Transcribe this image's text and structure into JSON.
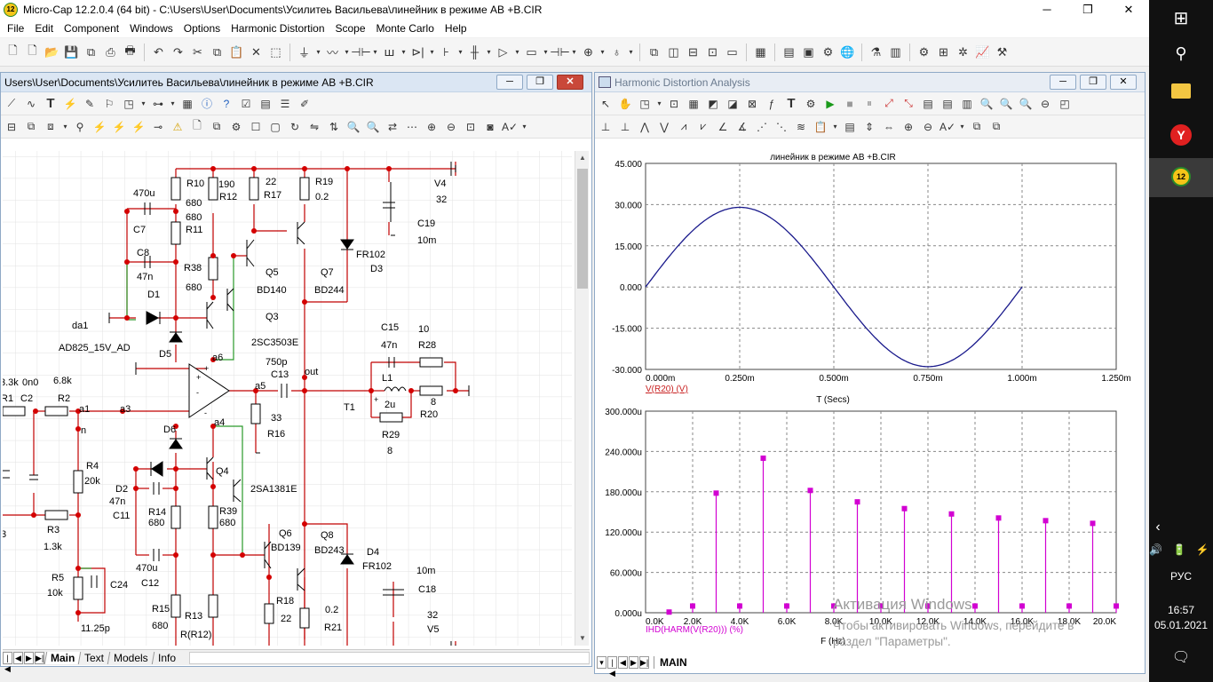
{
  "window": {
    "title": "Micro-Cap 12.2.0.4 (64 bit) - C:\\Users\\User\\Documents\\Усилитеь Васильева\\линейник в режиме АВ +B.CIR",
    "app_icon_text": "12",
    "min": "─",
    "max": "❐",
    "close": "✕"
  },
  "menu": [
    "File",
    "Edit",
    "Component",
    "Windows",
    "Options",
    "Harmonic Distortion",
    "Scope",
    "Monte Carlo",
    "Help"
  ],
  "schematic": {
    "title": "Users\\User\\Documents\\Усилитеь Васильева\\линейник в режиме АВ +B.CIR",
    "tabs": [
      "Main",
      "Text",
      "Models",
      "Info"
    ],
    "active_tab": "Main",
    "labels": {
      "r10": "R10",
      "r10v": "190",
      "r12": "R12",
      "r17v": "22",
      "r17": "R17",
      "r19": "R19",
      "r19v": "0.2",
      "v4": "V4",
      "v4v": "32",
      "c7v": "470u",
      "c7": "C7",
      "r10b": "680",
      "r11v": "680",
      "r11": "R11",
      "c19": "C19",
      "c19v": "10m",
      "c8": "C8",
      "c8v": "47n",
      "r38": "R38",
      "r38v": "680",
      "q5": "Q5",
      "q5t": "BD140",
      "q7": "Q7",
      "q7t": "BD244",
      "fr1": "FR102",
      "d3": "D3",
      "d1": "D1",
      "da1": "da1",
      "ad": "AD825_15V_AD",
      "q3": "Q3",
      "q3t": "2SC3503E",
      "d5": "D5",
      "a6": "a6",
      "c15": "C15",
      "c15v": "47n",
      "r28v": "10",
      "r28": "R28",
      "r750": "750p",
      "c13": "C13",
      "out": "out",
      "l1": "L1",
      "l1v": "2u",
      "r1v": "3.3k",
      "c2v": "0n0",
      "r2v": "6.8k",
      "r1": "R1",
      "c2": "C2",
      "r2": "R2",
      "a1": "a1",
      "a3": "a3",
      "a5": "a5",
      "t1": "T1",
      "r20v": "8",
      "r20": "R20",
      "r16v": "33",
      "r16": "R16",
      "r29": "R29",
      "r29v": "8",
      "n": "n",
      "a4": "a4",
      "d6": "D6",
      "r4": "R4",
      "r4v": "20k",
      "q4": "Q4",
      "q4t": "2SA1381E",
      "d2": "D2",
      "d2v": "47n",
      "c11": "C11",
      "r14": "R14",
      "r14v": "680",
      "r39": "R39",
      "r39v": "680",
      "r3": "R3",
      "r3v": "1.3k",
      "q6": "Q6",
      "q6t": "BD139",
      "q8": "Q8",
      "q8t": "BD243",
      "d4": "D4",
      "fr2": "FR102",
      "c12v": "470u",
      "c12": "C12",
      "c18v": "10m",
      "c18": "C18",
      "r5": "R5",
      "r5v": "10k",
      "c24": "C24",
      "r18": "R18",
      "r18v": "22",
      "r21v": "0.2",
      "r21": "R21",
      "r15": "R15",
      "r15v": "680",
      "r13": "R13",
      "r12b": "R(R12)",
      "c24v": "11.25p",
      "v5v": "32",
      "v5": "V5",
      "v3": "3"
    }
  },
  "hda": {
    "title": "Harmonic Distortion Analysis",
    "tabs": [
      "MAIN"
    ]
  },
  "chart_data": [
    {
      "type": "line",
      "title": "линейник в режиме АВ +B.CIR",
      "xlabel": "T (Secs)",
      "ylabel": "V(R20) (V)",
      "xlim": [
        0,
        0.00125
      ],
      "ylim": [
        -30,
        45
      ],
      "x_ticks": [
        "0.000m",
        "0.250m",
        "0.500m",
        "0.750m",
        "1.000m",
        "1.250m"
      ],
      "y_ticks": [
        "45.000",
        "30.000",
        "15.000",
        "0.000",
        "-15.000",
        "-30.000"
      ],
      "grid": true,
      "series": [
        {
          "name": "V(R20) (V)",
          "color": "#1a1a8c",
          "amplitude": 29,
          "period": 0.001,
          "x_end": 0.001
        }
      ]
    },
    {
      "type": "bar",
      "xlabel": "F (Hz)",
      "ylabel": "IHD(HARM(V(R20))) (%)",
      "xlim": [
        0,
        20000
      ],
      "ylim": [
        0,
        0.0003
      ],
      "x_ticks": [
        "0.0K",
        "2.0K",
        "4.0K",
        "6.0K",
        "8.0K",
        "10.0K",
        "12.0K",
        "14.0K",
        "16.0K",
        "18.0K",
        "20.0K"
      ],
      "y_ticks": [
        "300.000u",
        "240.000u",
        "180.000u",
        "120.000u",
        "60.000u",
        "0.000u"
      ],
      "grid": true,
      "series": [
        {
          "name": "IHD(HARM(V(R20))) (%)",
          "color": "#d200d2",
          "x": [
            1000,
            2000,
            3000,
            4000,
            5000,
            6000,
            7000,
            8000,
            9000,
            10000,
            11000,
            12000,
            13000,
            14000,
            15000,
            16000,
            17000,
            18000,
            19000,
            20000
          ],
          "values": [
            1e-06,
            1e-05,
            0.000178,
            1e-05,
            0.00023,
            1e-05,
            0.000182,
            1e-05,
            0.000165,
            1e-05,
            0.000155,
            1e-05,
            0.000147,
            1e-05,
            0.000141,
            1e-05,
            0.000137,
            1e-05,
            0.000133,
            1e-05
          ]
        }
      ]
    }
  ],
  "activation": {
    "line1": "Активация Windows",
    "line2": "Чтобы активировать Windows, перейдите в",
    "line3": "раздел \"Параметры\"."
  },
  "taskbar": {
    "lang": "РУС",
    "time": "16:57",
    "date": "05.01.2021",
    "app_badge": "12"
  }
}
